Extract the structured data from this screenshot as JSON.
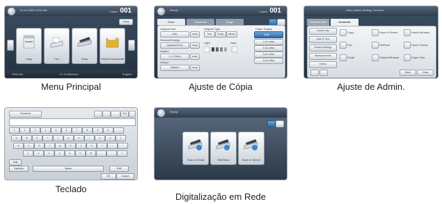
{
  "captions": {
    "menu": "Menu Principal",
    "copy": "Ajuste de Cópia",
    "admin": "Ajuste de Admin.",
    "keyboard": "Teclado",
    "scan": "Digitalização em Rede"
  },
  "main_menu": {
    "datetime": "01-01-2009 12:00 AM",
    "counter_label": "Copies",
    "counter": "001",
    "setup": "Setup",
    "apps": [
      "Copy",
      "Fax",
      "Scan",
      "Stored Documents"
    ],
    "bottom": [
      "Print Info",
      "1:1 Conference",
      "English"
    ]
  },
  "copy_settings": {
    "title": "Ready",
    "counter_label": "Copies",
    "counter": "001",
    "tabs": [
      "Basic",
      "Advanced",
      "Image"
    ],
    "original_size": "Original Size",
    "size_value": "Auto",
    "reduce": "Reduce/Enlarge",
    "reduce_value": "Original(100%)",
    "duplex": "Duplex",
    "duplex_value": "1->1 Sided",
    "output": "Output",
    "output_value": "Stacked",
    "original_type": "Original Type",
    "type_options": [
      "Text",
      "Photo",
      "Mixed"
    ],
    "darkness": "Light",
    "dark": "Dark",
    "paper_supply": "Paper Supply",
    "paper_auto": "Auto",
    "trays": [
      "1 A4 Letter",
      "2 A4 Letter",
      "3 A4 Letter",
      "4 A4 Letter"
    ],
    "more": "more"
  },
  "admin_settings": {
    "breadcrumb": "Help | Admin Setting | General",
    "tabs": [
      "Selected Item",
      "Contents"
    ],
    "left_items": [
      "Device Info",
      "Date & Time",
      "Default Settings",
      "Measurements",
      "Timers"
    ],
    "options": [
      [
        "Copy",
        "Scan to Server",
        "Home Window"
      ],
      [
        "Fax",
        "SetScan",
        "Home Hourly"
      ],
      [
        "Email",
        "Default Window",
        "Paper Size"
      ]
    ],
    "back": "Back",
    "close": "Close"
  },
  "keyboard": {
    "field": "Password",
    "rows": [
      [
        "1",
        "2",
        "3",
        "4",
        "5",
        "6",
        "7",
        "8",
        "9",
        "0",
        "-"
      ],
      [
        "q",
        "w",
        "e",
        "r",
        "t",
        "y",
        "u",
        "i",
        "o",
        "p",
        "["
      ],
      [
        "a",
        "s",
        "d",
        "f",
        "g",
        "h",
        "j",
        "k",
        "l",
        ";",
        "'"
      ],
      [
        "z",
        "x",
        "c",
        "v",
        "b",
        "n",
        "m",
        ",",
        ".",
        "/"
      ]
    ],
    "shift": "Shift",
    "symbols": "Symbols",
    "space": "Space",
    "ok": "OK",
    "cancel": "Cancel",
    "del": "Del"
  },
  "network_scan": {
    "title": "Ready",
    "items": [
      "Scan to Email",
      "WebScan",
      "Scan to Server"
    ]
  }
}
